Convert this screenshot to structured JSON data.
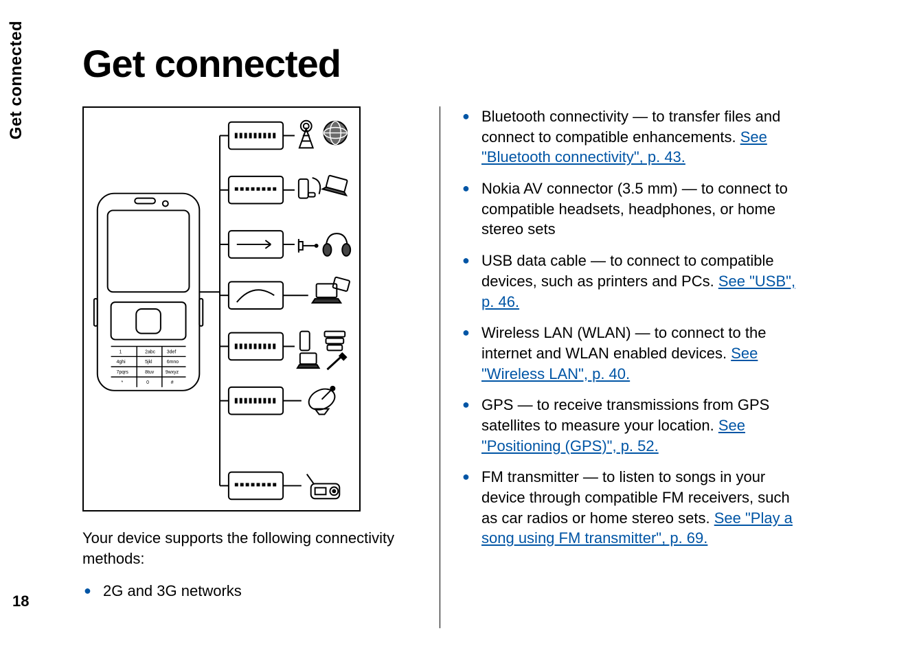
{
  "side_tab": "Get connected",
  "page_number": "18",
  "title": "Get connected",
  "intro": "Your device supports the following connectivity methods:",
  "col1_items": [
    {
      "text": "2G and 3G networks",
      "link": null
    }
  ],
  "col2_items": [
    {
      "text_before": "Bluetooth connectivity — to transfer files and connect to compatible enhancements. ",
      "link": "See \"Bluetooth connectivity\", p. 43.",
      "text_after": ""
    },
    {
      "text_before": "Nokia AV connector (3.5 mm) — to connect to compatible headsets, headphones, or home stereo sets",
      "link": null,
      "text_after": ""
    },
    {
      "text_before": "USB data cable — to connect to compatible devices, such as printers and PCs. ",
      "link": "See \"USB\", p. 46.",
      "text_after": ""
    },
    {
      "text_before": "Wireless LAN (WLAN) — to connect to the internet and WLAN enabled devices. ",
      "link": "See \"Wireless LAN\", p. 40.",
      "text_after": ""
    },
    {
      "text_before": "GPS — to receive transmissions from GPS satellites to measure your location. ",
      "link": "See \"Positioning (GPS)\", p. 52.",
      "text_after": ""
    },
    {
      "text_before": "FM transmitter — to listen to songs in your device through compatible FM receivers, such as car radios or home stereo sets. ",
      "link": "See \"Play a song using FM transmitter\", p. 69.",
      "text_after": ""
    }
  ]
}
